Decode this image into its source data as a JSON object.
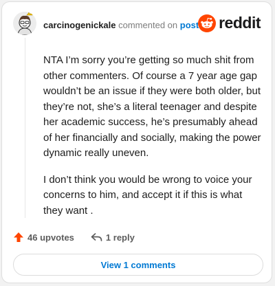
{
  "comment": {
    "username": "carcinogenickale",
    "action_text": "commented on",
    "post_link": "post",
    "paragraphs": [
      "NTA I’m sorry you’re getting so much shit from other commenters. Of course a 7 year age gap wouldn’t be an issue if they were both older, but they’re not, she’s a literal teenager and despite her academic success, he’s presumably ahead of her financially and socially, making the power dynamic really uneven.",
      "I don’t think you would be wrong to voice your concerns to him, and accept it if this is what they want ."
    ],
    "upvotes_label": "46 upvotes",
    "replies_label": "1 reply",
    "view_comments_label": "View 1 comments"
  },
  "brand": {
    "wordmark": "reddit",
    "logo_icon": "reddit-snoo-icon"
  },
  "icons": {
    "upvote": "upvote-arrow-icon",
    "reply": "reply-arrow-icon"
  },
  "colors": {
    "reddit_orange": "#ff4500",
    "link_blue": "#0079d3",
    "text_dark": "#1c1c1c",
    "text_muted": "#7c7c7c"
  }
}
